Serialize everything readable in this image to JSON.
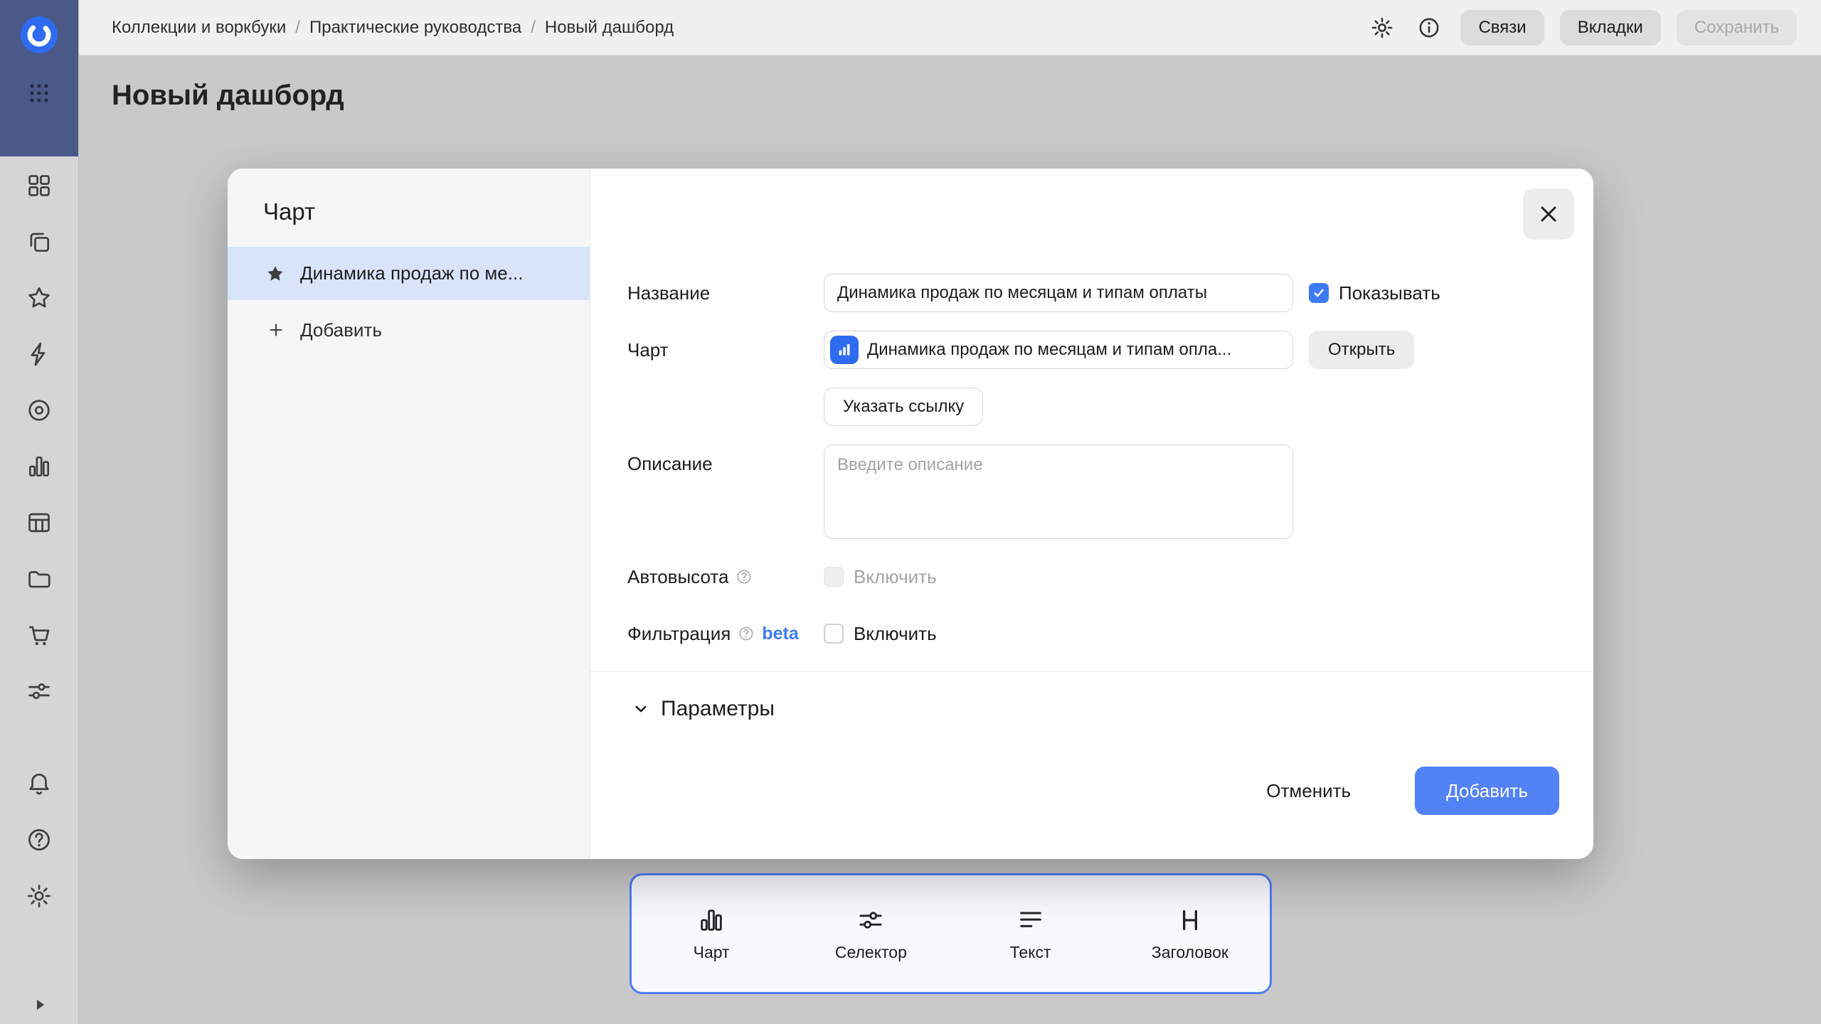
{
  "header": {
    "breadcrumbs": [
      "Коллекции и воркбуки",
      "Практические руководства",
      "Новый дашборд"
    ],
    "separator": "/",
    "actions": {
      "links": "Связи",
      "tabs": "Вкладки",
      "save": "Сохранить"
    }
  },
  "page": {
    "title": "Новый дашборд"
  },
  "sidebar": {
    "icons": [
      "datalens-logo",
      "apps-grid-icon",
      "dashboards-icon",
      "workbooks-icon",
      "favorites-icon",
      "editor-icon",
      "datasets-icon",
      "charts-icon",
      "tables-icon",
      "files-icon",
      "marketplace-icon",
      "services-icon",
      "notifications-icon",
      "help-icon",
      "settings-icon",
      "collapse-icon"
    ]
  },
  "modal": {
    "panel": {
      "title": "Чарт",
      "selected_item": "Динамика продаж по ме...",
      "add_label": "Добавить"
    },
    "form": {
      "name_label": "Название",
      "name_value": "Динамика продаж по месяцам и типам оплаты",
      "show_label": "Показывать",
      "chart_label": "Чарт",
      "chart_value": "Динамика продаж по месяцам и типам опла...",
      "open_button": "Открыть",
      "link_button": "Указать ссылку",
      "description_label": "Описание",
      "description_placeholder": "Введите описание",
      "autoheight_label": "Автовысота",
      "autoheight_toggle": "Включить",
      "filtering_label": "Фильтрация",
      "beta_badge": "beta",
      "filtering_toggle": "Включить",
      "params_label": "Параметры"
    },
    "footer": {
      "cancel": "Отменить",
      "submit": "Добавить"
    }
  },
  "bottom_panel": {
    "items": [
      {
        "label": "Чарт",
        "icon": "chart-icon"
      },
      {
        "label": "Селектор",
        "icon": "selector-icon"
      },
      {
        "label": "Текст",
        "icon": "text-icon"
      },
      {
        "label": "Заголовок",
        "icon": "heading-icon"
      }
    ]
  },
  "colors": {
    "accent_blue": "#5282f5",
    "checkbox_blue": "#3d7af5",
    "beta_blue": "#3d7af5",
    "dock_border": "#4f7ef7",
    "overlay_gray": "#c9c9c9",
    "rail_top": "#4a5988",
    "selected_item_bg": "#d9e4fa"
  }
}
